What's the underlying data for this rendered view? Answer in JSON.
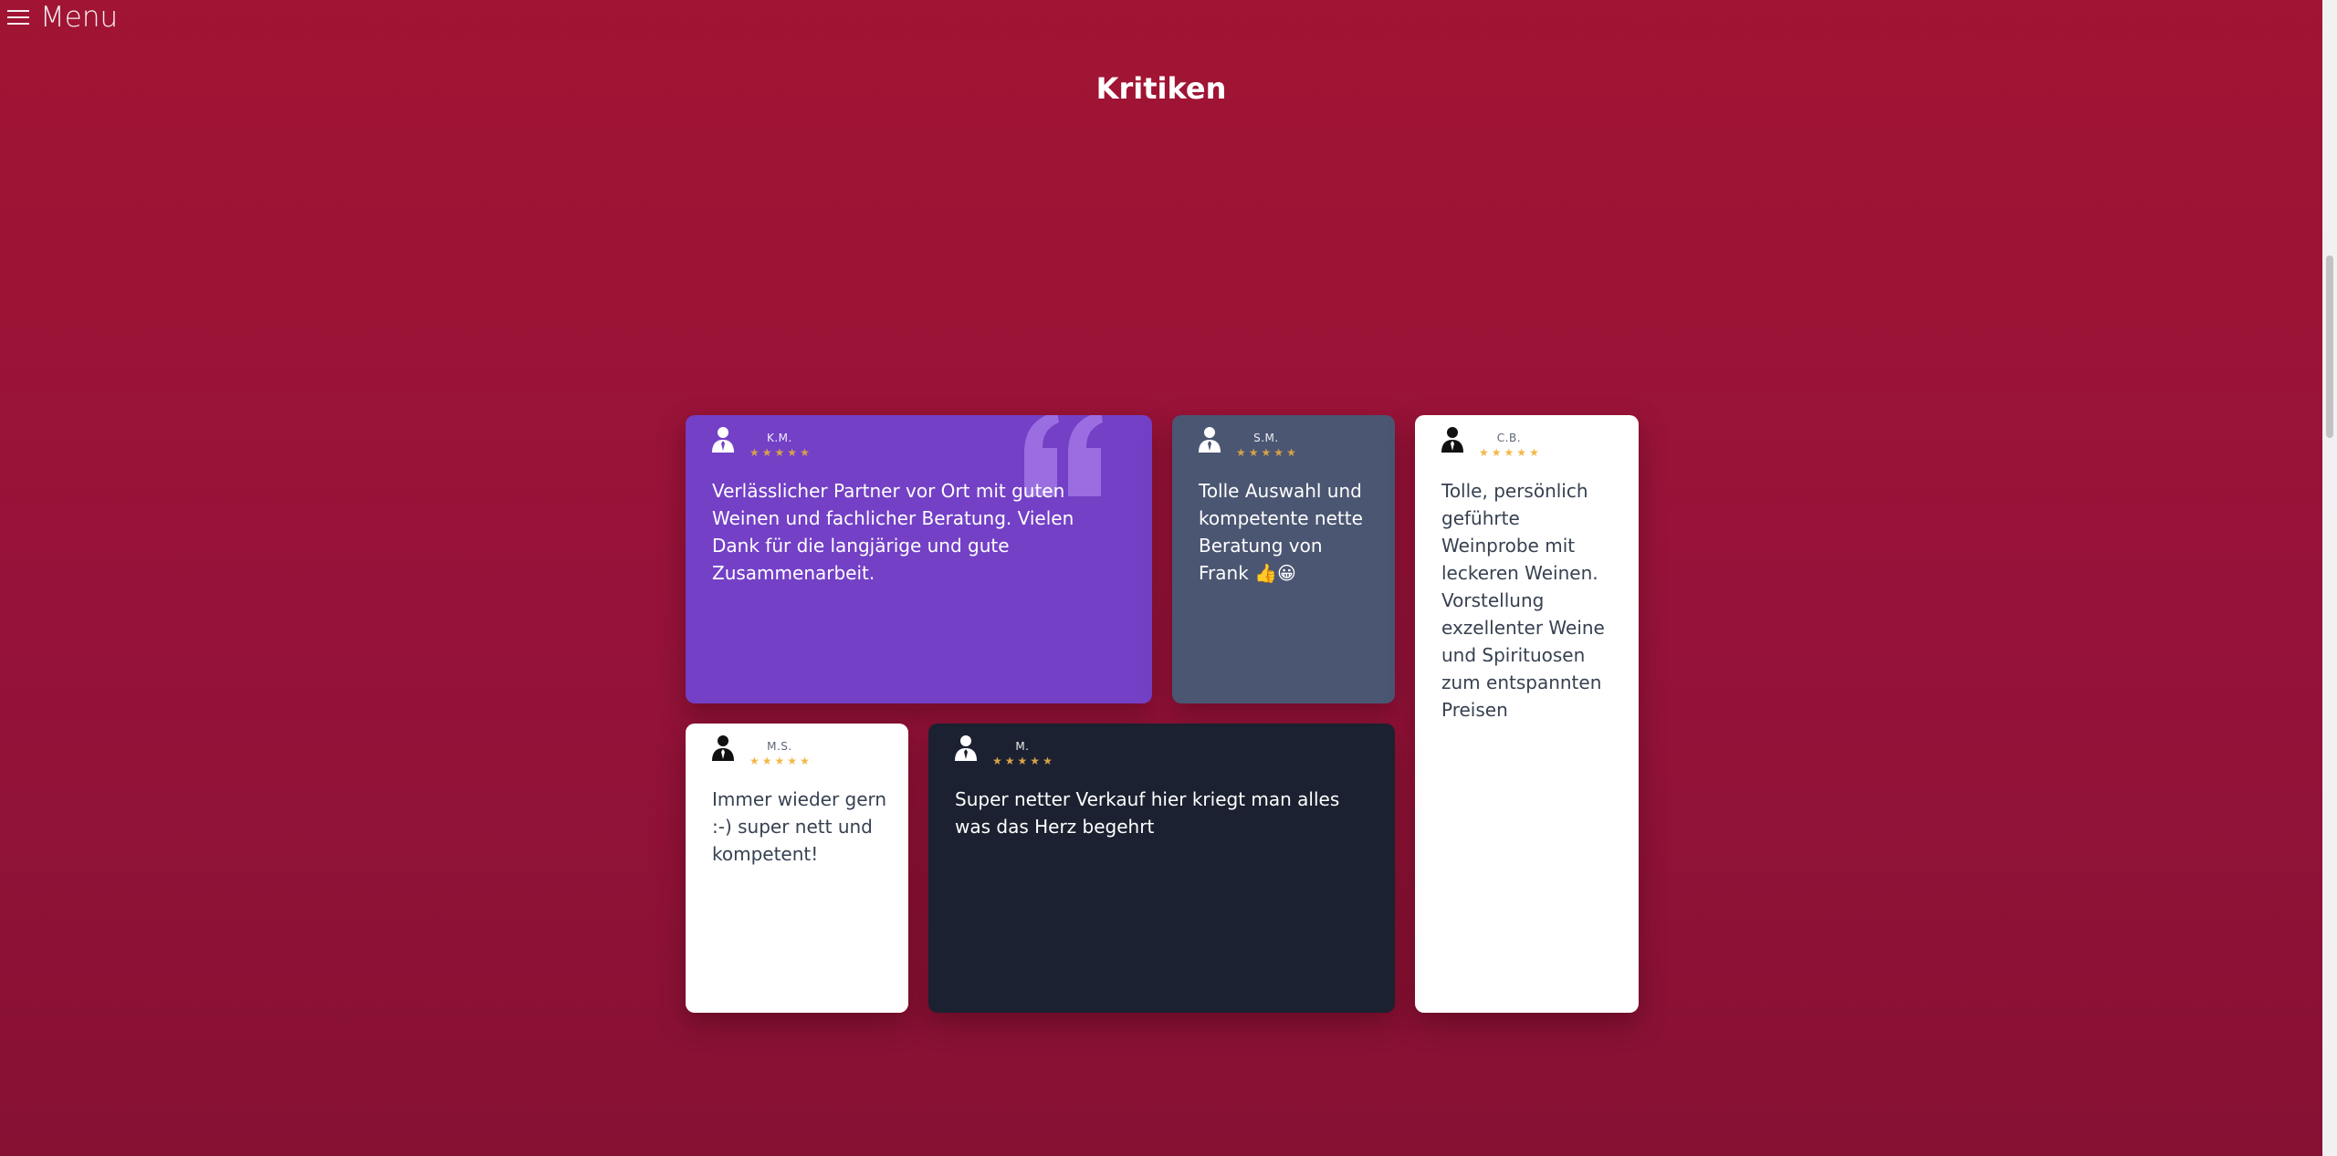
{
  "menu": {
    "label": "Menu",
    "icon": "hamburger-icon"
  },
  "section": {
    "title": "Kritiken"
  },
  "colors": {
    "background": "#9e1435",
    "star": "#f2b84b",
    "card_purple": "#7340c6",
    "card_slate": "#4b5672",
    "card_white": "#ffffff",
    "card_dark": "#1b2130"
  },
  "reviews": [
    {
      "name": "K.M.",
      "rating": 5,
      "text": "Verlässlicher Partner vor Ort mit guten Weinen und fachlicher Beratung. Vielen Dank für die langjärige und gute Zusammenarbeit.",
      "style": "purple",
      "icon": "quote-icon"
    },
    {
      "name": "S.M.",
      "rating": 5,
      "text": "Tolle Auswahl und kompetente nette Beratung von Frank 👍😀",
      "style": "slate"
    },
    {
      "name": "C.B.",
      "rating": 5,
      "text": "Tolle, persönlich geführte Weinprobe mit leckeren Weinen. Vorstellung exzellenter Weine und Spirituosen zum entspannten Preisen",
      "style": "white"
    },
    {
      "name": "M.S.",
      "rating": 5,
      "text": "Immer wieder gern :-) super nett und kompetent!",
      "style": "white"
    },
    {
      "name": "M.",
      "rating": 5,
      "text": "Super netter Verkauf hier kriegt man alles was das Herz begehrt",
      "style": "dark"
    }
  ]
}
